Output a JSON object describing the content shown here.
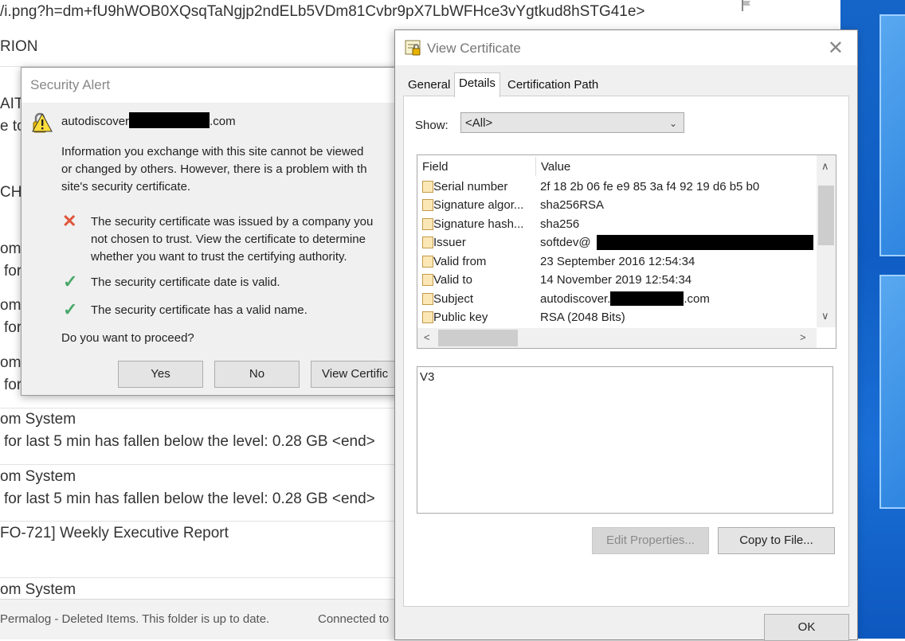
{
  "browser": {
    "url": "/i.png?h=dm+fU9hWOB0XQsqTaNgjp2ndELb5VDm81Cvbr9pX7LbWFHce3vYgtkud8hSTG41e>"
  },
  "outlook": {
    "folder": "RION",
    "fragments": [
      "AIT-",
      "e to",
      "CHA",
      "om",
      "for",
      "om",
      "for",
      "om",
      "for"
    ],
    "messages": [
      {
        "sender": "om System",
        "preview": "for last 5 min has fallen below the level: 0.28 GB <end>"
      },
      {
        "sender": "om System",
        "preview": "for last 5 min has fallen below the level: 0.28 GB <end>"
      },
      {
        "sender": "FO-721] Weekly Executive Report",
        "preview": ""
      },
      {
        "sender": "om System",
        "preview": ""
      }
    ],
    "status_left": "Permalog - Deleted Items.  This folder is up to date.",
    "status_right": "Connected to"
  },
  "security_alert": {
    "title": "Security Alert",
    "site_prefix": "autodiscover",
    "site_suffix": ".com",
    "intro": [
      "Information you exchange with this site cannot be viewed",
      "or changed by others. However, there is a problem with th",
      "site's security certificate."
    ],
    "issues": [
      {
        "icon": "error-x-icon",
        "lines": [
          "The security certificate was issued by a company you",
          "not chosen to trust. View the certificate to determine",
          "whether you want to trust the certifying authority."
        ]
      },
      {
        "icon": "check-icon",
        "lines": [
          "The security certificate date is valid."
        ]
      },
      {
        "icon": "check-icon",
        "lines": [
          "The security certificate has a valid name."
        ]
      }
    ],
    "question": "Do you want to proceed?",
    "buttons": {
      "yes": "Yes",
      "no": "No",
      "view": "View Certific"
    }
  },
  "view_certificate": {
    "title": "View Certificate",
    "close_glyph": "✕",
    "tabs": [
      "General",
      "Details",
      "Certification Path"
    ],
    "active_tab": "Details",
    "show_label": "Show:",
    "show_value": "<All>",
    "columns": {
      "field": "Field",
      "value": "Value"
    },
    "rows": [
      {
        "field": "Serial number",
        "value": "2f 18 2b 06 fe e9 85 3a f4 92 19 d6 b5 b0"
      },
      {
        "field": "Signature algor...",
        "value": "sha256RSA"
      },
      {
        "field": "Signature hash...",
        "value": "sha256"
      },
      {
        "field": "Issuer",
        "value": "softdev@"
      },
      {
        "field": "Valid from",
        "value": "23 September 2016 12:54:34"
      },
      {
        "field": "Valid to",
        "value": "14 November 2019 12:54:34"
      },
      {
        "field": "Subject",
        "value": "autodiscover.",
        "value_suffix": ".com"
      },
      {
        "field": "Public key",
        "value": "RSA (2048 Bits)"
      }
    ],
    "detail_value": "V3",
    "buttons": {
      "edit": "Edit Properties...",
      "copy": "Copy to File...",
      "ok": "OK"
    }
  },
  "colors": {
    "accent": "#0f5dc4",
    "error": "#e0543a",
    "ok": "#4aa86a"
  }
}
